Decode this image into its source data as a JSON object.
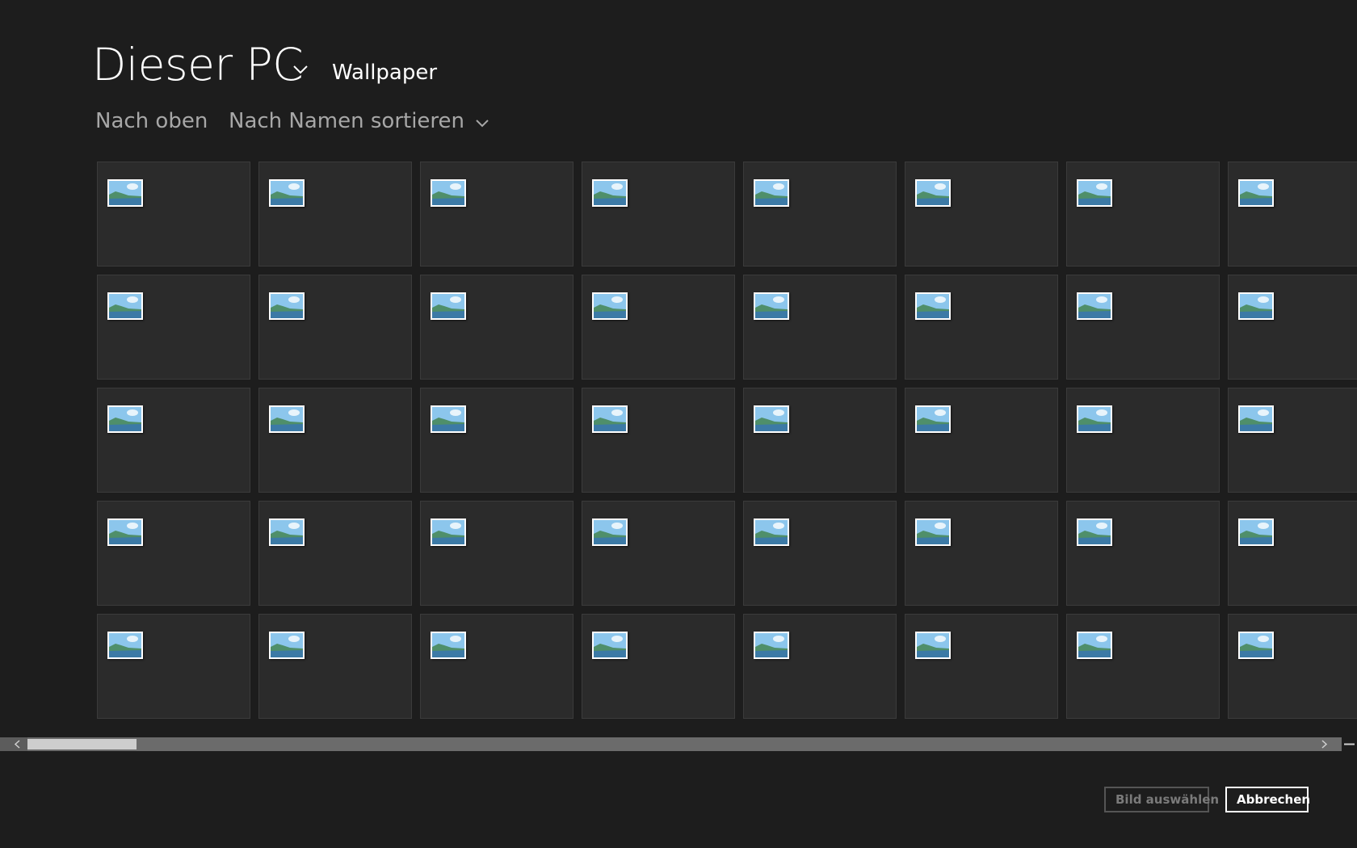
{
  "header": {
    "location": "Dieser PC",
    "folder": "Wallpaper",
    "location_dropdown_icon": "chevron-down-icon"
  },
  "commands": {
    "up_label": "Nach oben",
    "sort_label": "Nach Namen sortieren",
    "sort_dropdown_icon": "chevron-down-icon"
  },
  "grid": {
    "columns": 8,
    "rows": 5,
    "tile_icon": "image-file-icon"
  },
  "scrollbar": {
    "left_icon": "chevron-left-icon",
    "right_icon": "chevron-right-icon",
    "zoom_icon": "minus-icon"
  },
  "footer": {
    "select_label": "Bild auswählen",
    "cancel_label": "Abbrechen"
  },
  "colors": {
    "background": "#1d1d1d",
    "tile": "#2b2b2b",
    "muted_text": "#a7a7a7",
    "disabled_text": "#7a7a7a"
  }
}
